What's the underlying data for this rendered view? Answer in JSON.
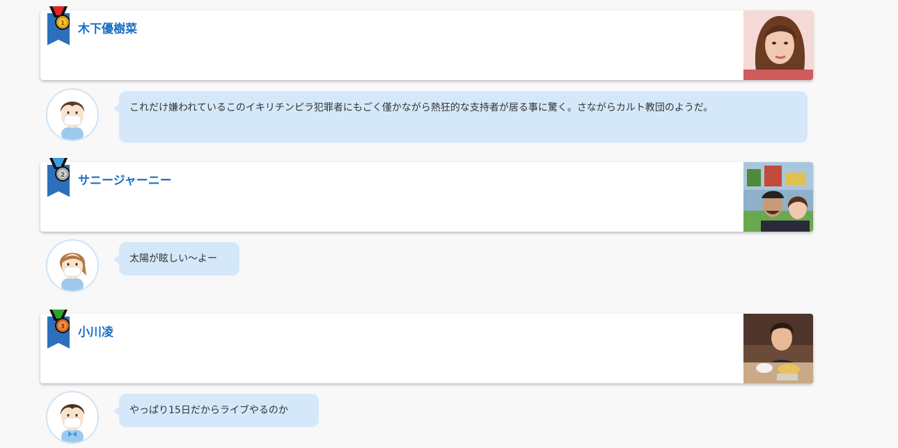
{
  "rankings": [
    {
      "rank": 1,
      "name": "木下優樹菜",
      "medal_color": "#d9a21b",
      "ribbon_stripe": "#e0262b",
      "comment": "これだけ嫌われているこのイキリチンピラ犯罪者にもごく僅かながら熱狂的な支持者が居る事に驚く。さながらカルト教団のようだ。",
      "avatar": "boy-mask-avatar"
    },
    {
      "rank": 2,
      "name": "サニージャーニー",
      "medal_color": "#a7a7a7",
      "ribbon_stripe": "#3a9fe0",
      "comment": "太陽が眩しい〜よー",
      "avatar": "girl-mask-avatar"
    },
    {
      "rank": 3,
      "name": "小川凌",
      "medal_color": "#d96a1f",
      "ribbon_stripe": "#2fa32f",
      "comment": "やっぱり15日だからライブやるのか",
      "avatar": "boy-bowtie-mask-avatar"
    }
  ],
  "colors": {
    "link": "#1a6fc4",
    "ribbon": "#2c6fbd",
    "bubble": "#d4e8fa",
    "background": "#f8f8f8"
  }
}
